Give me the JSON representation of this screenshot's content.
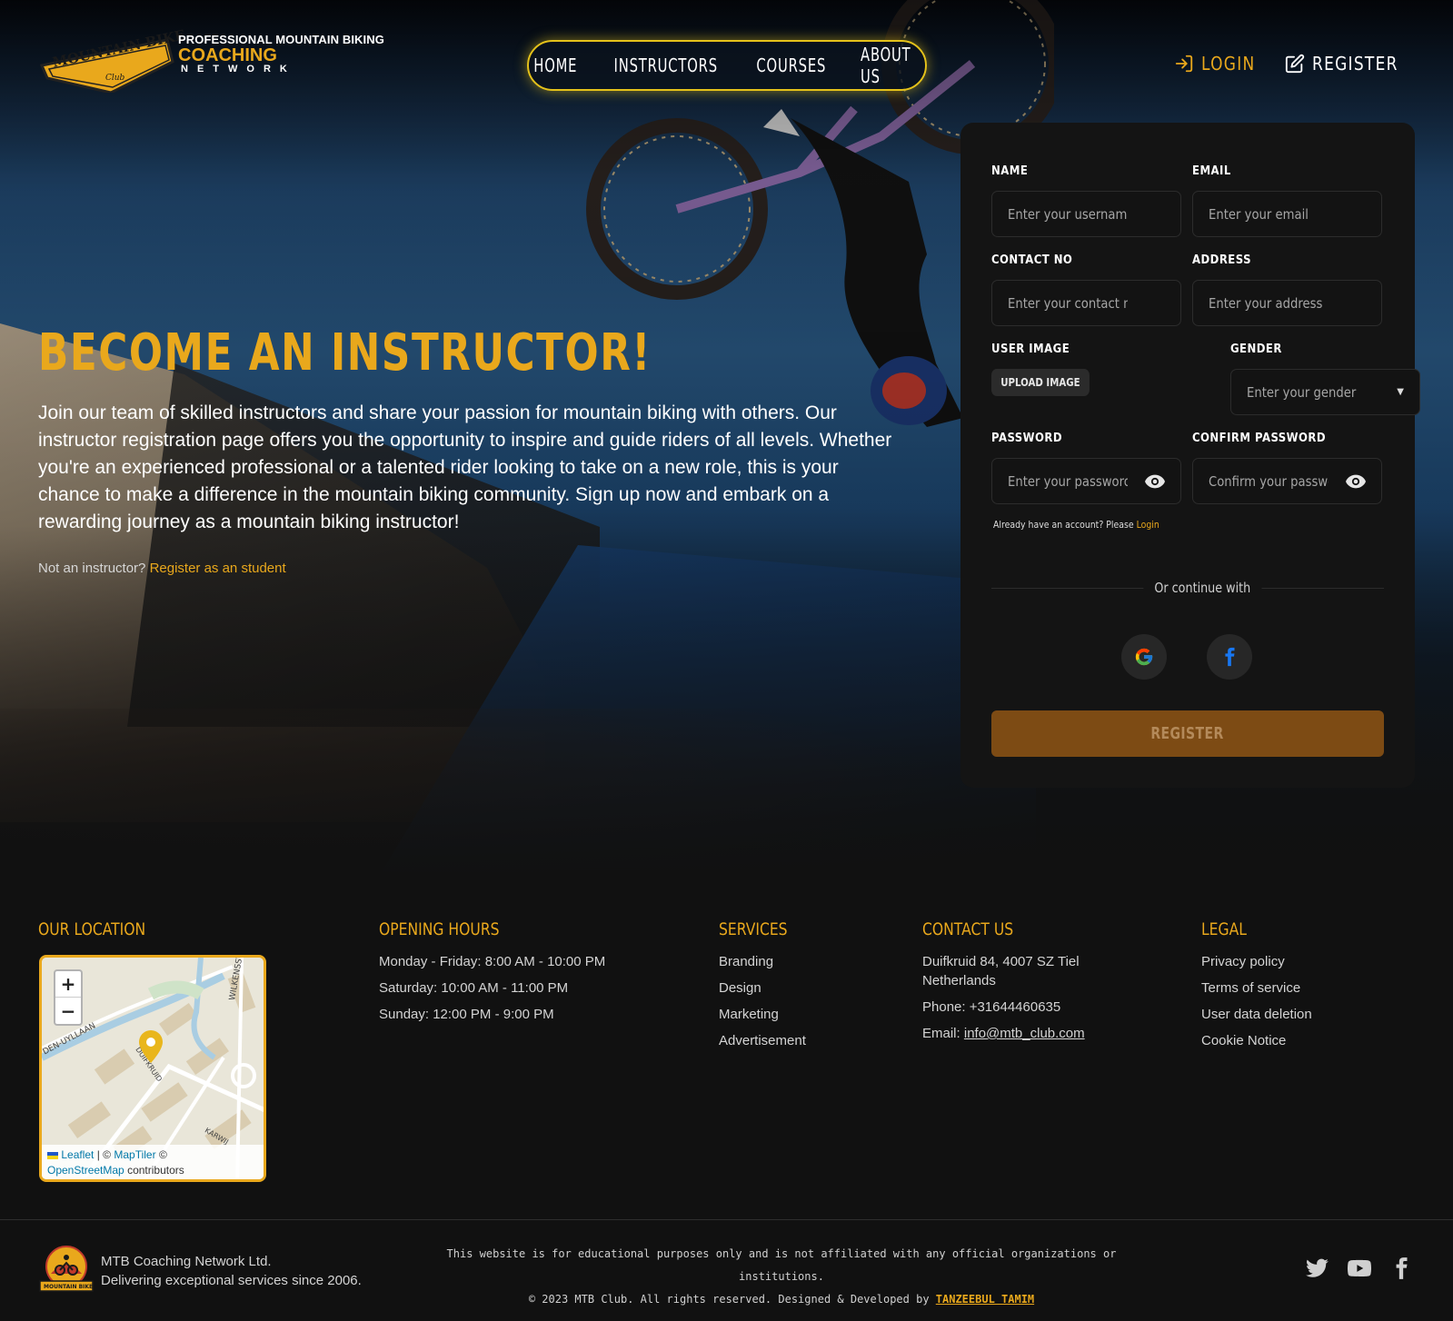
{
  "brand": {
    "badge_text": "MOUNTAIN BIKE",
    "badge_sub": "Club",
    "line1": "PROFESSIONAL MOUNTAIN BIKING",
    "line2": "COACHING",
    "line3": "NETWORK"
  },
  "nav": {
    "items": [
      "HOME",
      "INSTRUCTORS",
      "COURSES",
      "ABOUT US"
    ]
  },
  "auth": {
    "login": "LOGIN",
    "register": "REGISTER"
  },
  "hero": {
    "title": "BECOME AN INSTRUCTOR!",
    "description": "Join our team of skilled instructors and share your passion for mountain biking with others. Our instructor registration page offers you the opportunity to inspire and guide riders of all levels. Whether you're an experienced professional or a talented rider looking to take on a new role, this is your chance to make a difference in the mountain biking community. Sign up now and embark on a rewarding journey as a mountain biking instructor!",
    "alt_prefix": "Not an instructor?",
    "alt_link": "Register as an student"
  },
  "form": {
    "name_label": "NAME",
    "name_placeholder": "Enter your username",
    "email_label": "EMAIL",
    "email_placeholder": "Enter your email",
    "contact_label": "CONTACT NO",
    "contact_placeholder": "Enter your contact no",
    "address_label": "ADDRESS",
    "address_placeholder": "Enter your address",
    "image_label": "USER IMAGE",
    "upload_label": "UPLOAD IMAGE",
    "gender_label": "GENDER",
    "gender_placeholder": "Enter your gender",
    "password_label": "PASSWORD",
    "password_placeholder": "Enter your password",
    "confirm_label": "CONFIRM PASSWORD",
    "confirm_placeholder": "Confirm your password",
    "already_text": "Already have an account? Please",
    "already_link": "Login",
    "continue_text": "Or continue with",
    "register_button": "REGISTER"
  },
  "footer": {
    "location": {
      "title": "OUR LOCATION",
      "map_attr_leaflet": "Leaflet",
      "map_attr_sep": "| ©",
      "map_attr_maptiler": "MapTiler",
      "map_attr_copy": "©",
      "map_attr_osm": "OpenStreetMap",
      "map_attr_contrib": "contributors",
      "zoom_in": "+",
      "zoom_out": "−",
      "street_1": "WILKENSSTR",
      "street_2": "DEN-UYLLAAN",
      "street_3": "DUIFKRUID",
      "street_4": "KARWIJ"
    },
    "hours": {
      "title": "OPENING HOURS",
      "items": [
        "Monday - Friday: 8:00 AM - 10:00 PM",
        "Saturday: 10:00 AM - 11:00 PM",
        "Sunday: 12:00 PM - 9:00 PM"
      ]
    },
    "services": {
      "title": "SERVICES",
      "items": [
        "Branding",
        "Design",
        "Marketing",
        "Advertisement"
      ]
    },
    "contact": {
      "title": "CONTACT US",
      "address_line1": "Duifkruid 84, 4007 SZ Tiel",
      "address_line2": "Netherlands",
      "phone": "Phone: +31644460635",
      "email_prefix": "Email:",
      "email": "info@mtb_club.com"
    },
    "legal": {
      "title": "LEGAL",
      "items": [
        "Privacy policy",
        "Terms of service",
        "User data deletion",
        "Cookie Notice"
      ]
    },
    "company_name": "MTB Coaching Network Ltd.",
    "company_tagline": "Delivering exceptional services since 2006.",
    "disclaimer": "This website is for educational purposes only and is not affiliated with any official organizations or institutions.",
    "copyright": "© 2023 MTB Club. All rights reserved. Designed & Developed by",
    "developer": "TANZEEBUL TAMIM",
    "bottom_logo_text": "MOUNTAIN BIKE"
  },
  "colors": {
    "accent": "#e9a81c",
    "nav_border": "#e5c21a",
    "card_bg": "#141414",
    "register_button": "#7d4b14"
  },
  "icons": {
    "login": "login-arrow-icon",
    "register": "edit-icon",
    "eye": "eye-icon",
    "google": "google-icon",
    "facebook": "facebook-icon",
    "twitter": "twitter-icon",
    "youtube": "youtube-icon"
  }
}
